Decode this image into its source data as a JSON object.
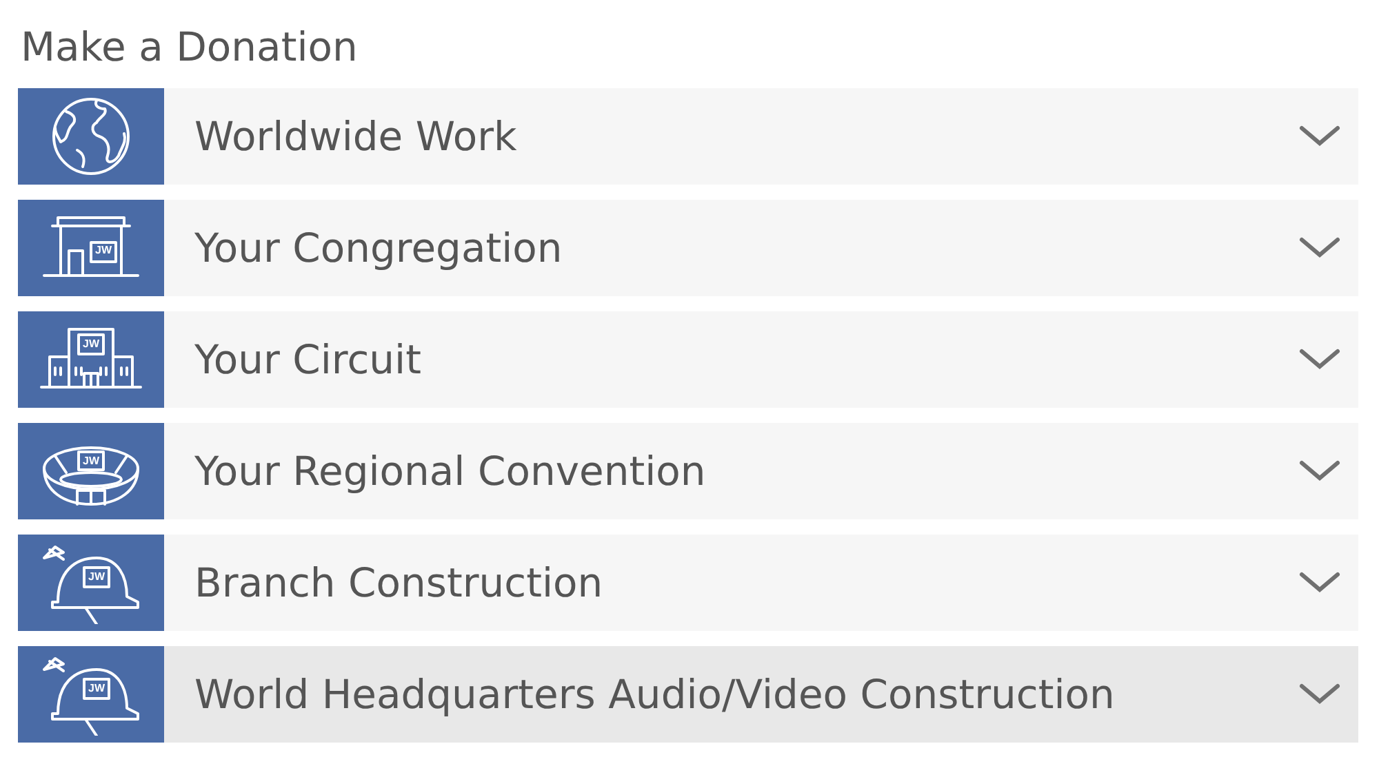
{
  "title": "Make a Donation",
  "items": [
    {
      "label": "Worldwide Work",
      "kind": "globe",
      "selected": false
    },
    {
      "label": "Your Congregation",
      "kind": "hall",
      "badge": "JW",
      "selected": false
    },
    {
      "label": "Your Circuit",
      "kind": "assembly",
      "badge": "JW",
      "selected": false
    },
    {
      "label": "Your Regional Convention",
      "kind": "stadium",
      "badge": "JW",
      "selected": false
    },
    {
      "label": "Branch Construction",
      "kind": "helmet",
      "badge": "JW",
      "selected": false
    },
    {
      "label": "World Headquarters Audio/Video Construction",
      "kind": "helmet",
      "badge": "JW",
      "selected": true
    }
  ]
}
